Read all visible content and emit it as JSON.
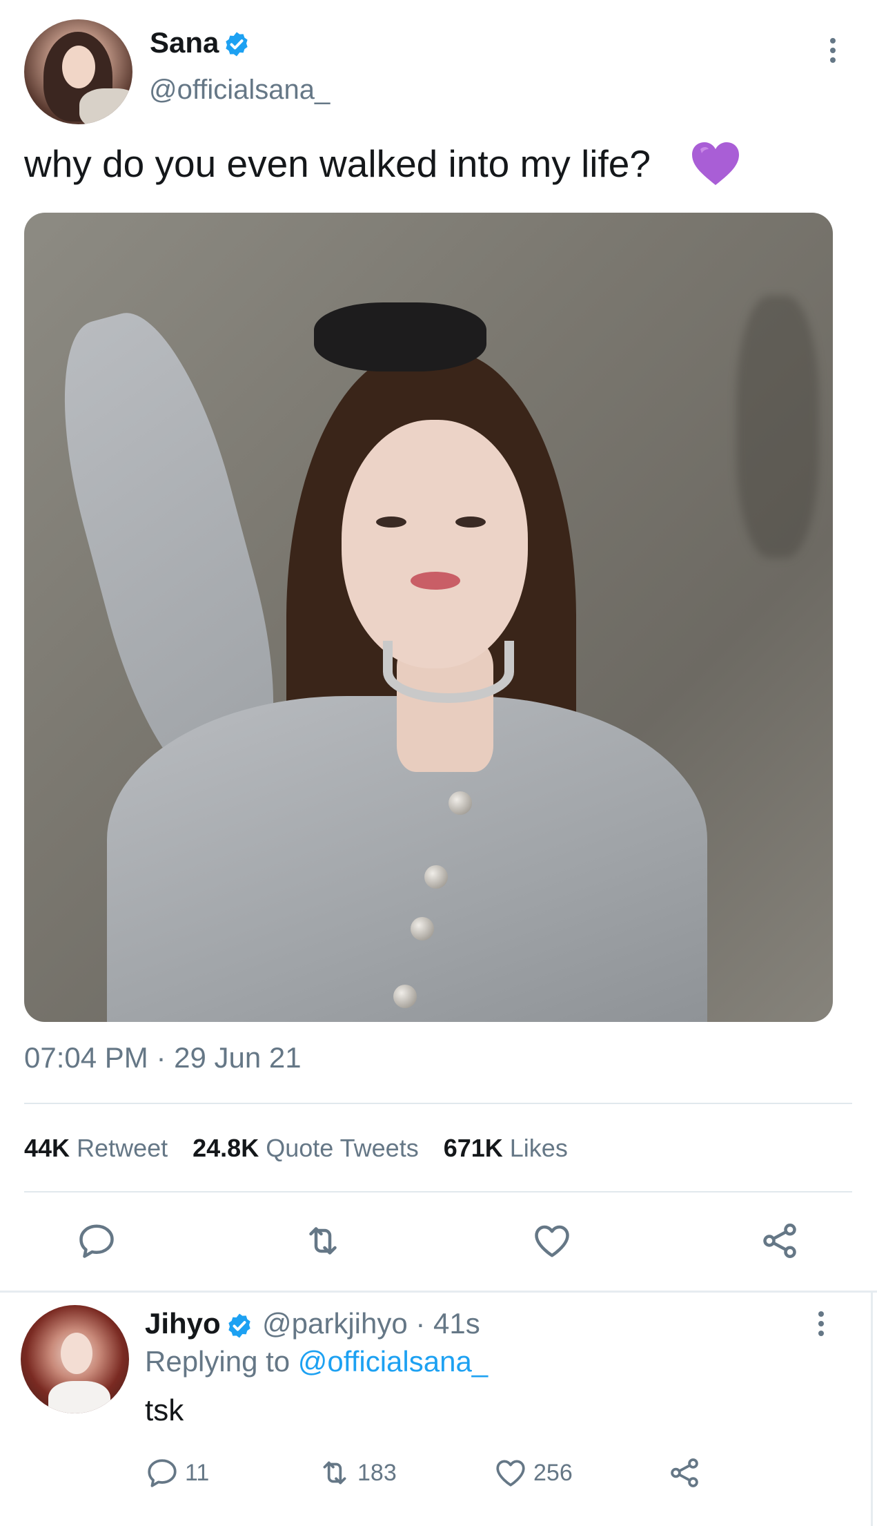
{
  "tweet": {
    "author": {
      "display_name": "Sana",
      "handle": "@officialsana_",
      "verified": true
    },
    "text": "why do you even walked into my life?",
    "emoji": "purple-heart",
    "timestamp": "07:04 PM · 29 Jun 21",
    "stats": {
      "retweets_count": "44K",
      "retweets_label": "Retweet",
      "quotes_count": "24.8K",
      "quotes_label": "Quote Tweets",
      "likes_count": "671K",
      "likes_label": "Likes"
    }
  },
  "reply": {
    "author": {
      "display_name": "Jihyo",
      "handle": "@parkjihyo",
      "verified": true
    },
    "meta": "@parkjihyo · 41s",
    "replying_prefix": "Replying to",
    "replying_to": "@officialsana_",
    "text": "tsk",
    "counts": {
      "replies": "11",
      "retweets": "183",
      "likes": "256"
    }
  },
  "colors": {
    "accent": "#1da1f2",
    "muted": "#657786",
    "text": "#14171a",
    "divider": "#e1e8ed",
    "emoji_purple": "#a95ed6"
  }
}
